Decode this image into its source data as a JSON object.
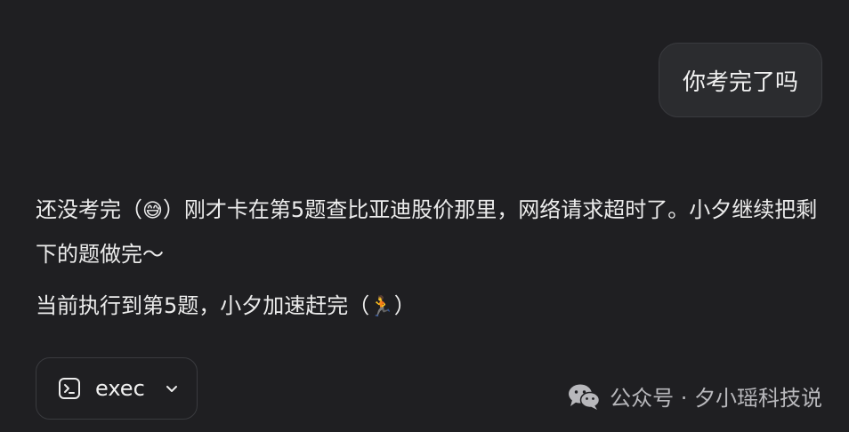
{
  "user_message": "你考完了吗",
  "assistant": {
    "para1_a": "还没考完（",
    "para1_emoji": "😅",
    "para1_b": "）刚才卡在第5题查比亚迪股价那里，网络请求超时了。小夕继续把剩下的题做完～",
    "para2_a": "当前执行到第5题，小夕加速赶完（",
    "para2_emoji": "🏃",
    "para2_b": "）"
  },
  "tool_call": {
    "label": "exec",
    "icon": "terminal-icon",
    "chevron": "chevron-down-icon"
  },
  "watermark": {
    "icon": "wechat-icon",
    "text": "公众号 · 夕小瑶科技说"
  },
  "colors": {
    "background": "#1f1f22",
    "bubble": "#2b2c2f",
    "border": "#3a3b3f",
    "text": "#ececec"
  }
}
